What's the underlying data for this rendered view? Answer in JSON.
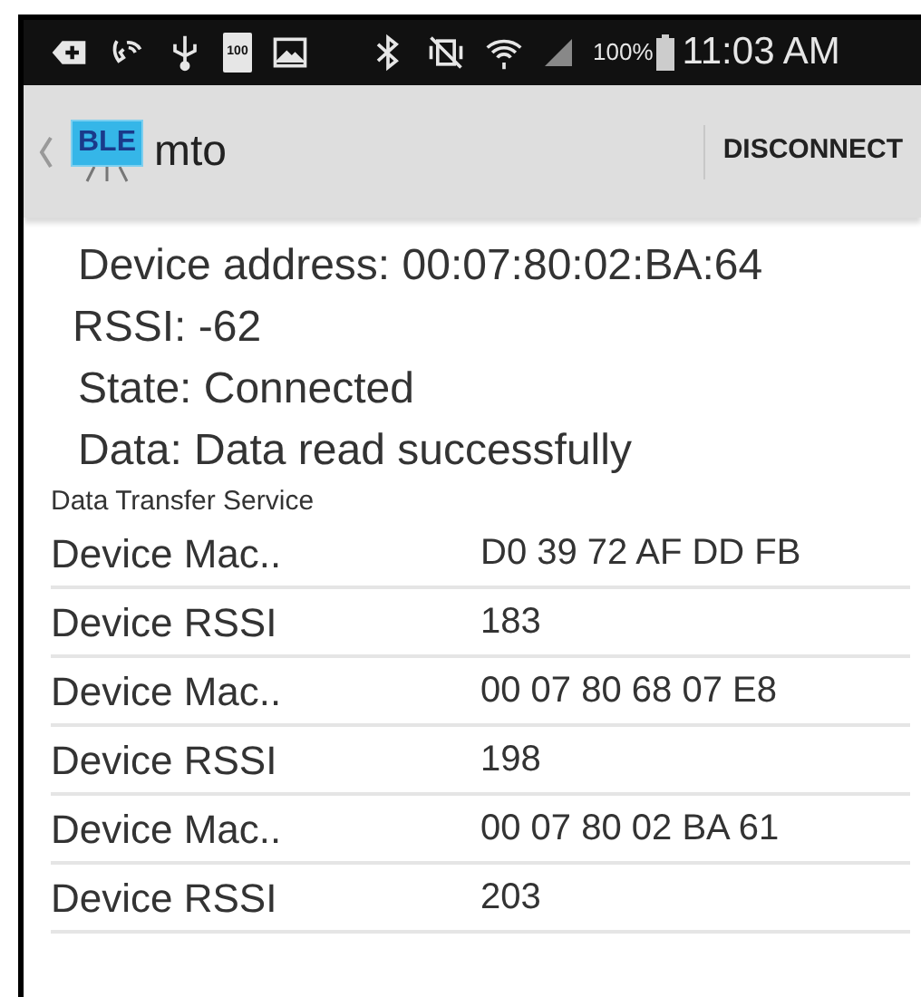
{
  "status_bar": {
    "battery_icon_text": "100",
    "battery_percent": "100%",
    "time": "11:03 AM"
  },
  "action_bar": {
    "app_icon_text": "BLE",
    "title": "mto",
    "action": "DISCONNECT"
  },
  "info": [
    "Device address:  00:07:80:02:BA:64",
    "RSSI: -62",
    "State: Connected",
    "Data: Data read successfully"
  ],
  "service": {
    "title": "Data Transfer Service",
    "rows": [
      {
        "label": "Device Mac..",
        "value": "D0 39 72 AF DD FB"
      },
      {
        "label": "Device RSSI",
        "value": "183"
      },
      {
        "label": "Device Mac..",
        "value": "00 07 80 68 07 E8"
      },
      {
        "label": "Device RSSI",
        "value": "198"
      },
      {
        "label": "Device Mac..",
        "value": "00 07 80 02 BA 61"
      },
      {
        "label": "Device RSSI",
        "value": "203"
      }
    ]
  }
}
